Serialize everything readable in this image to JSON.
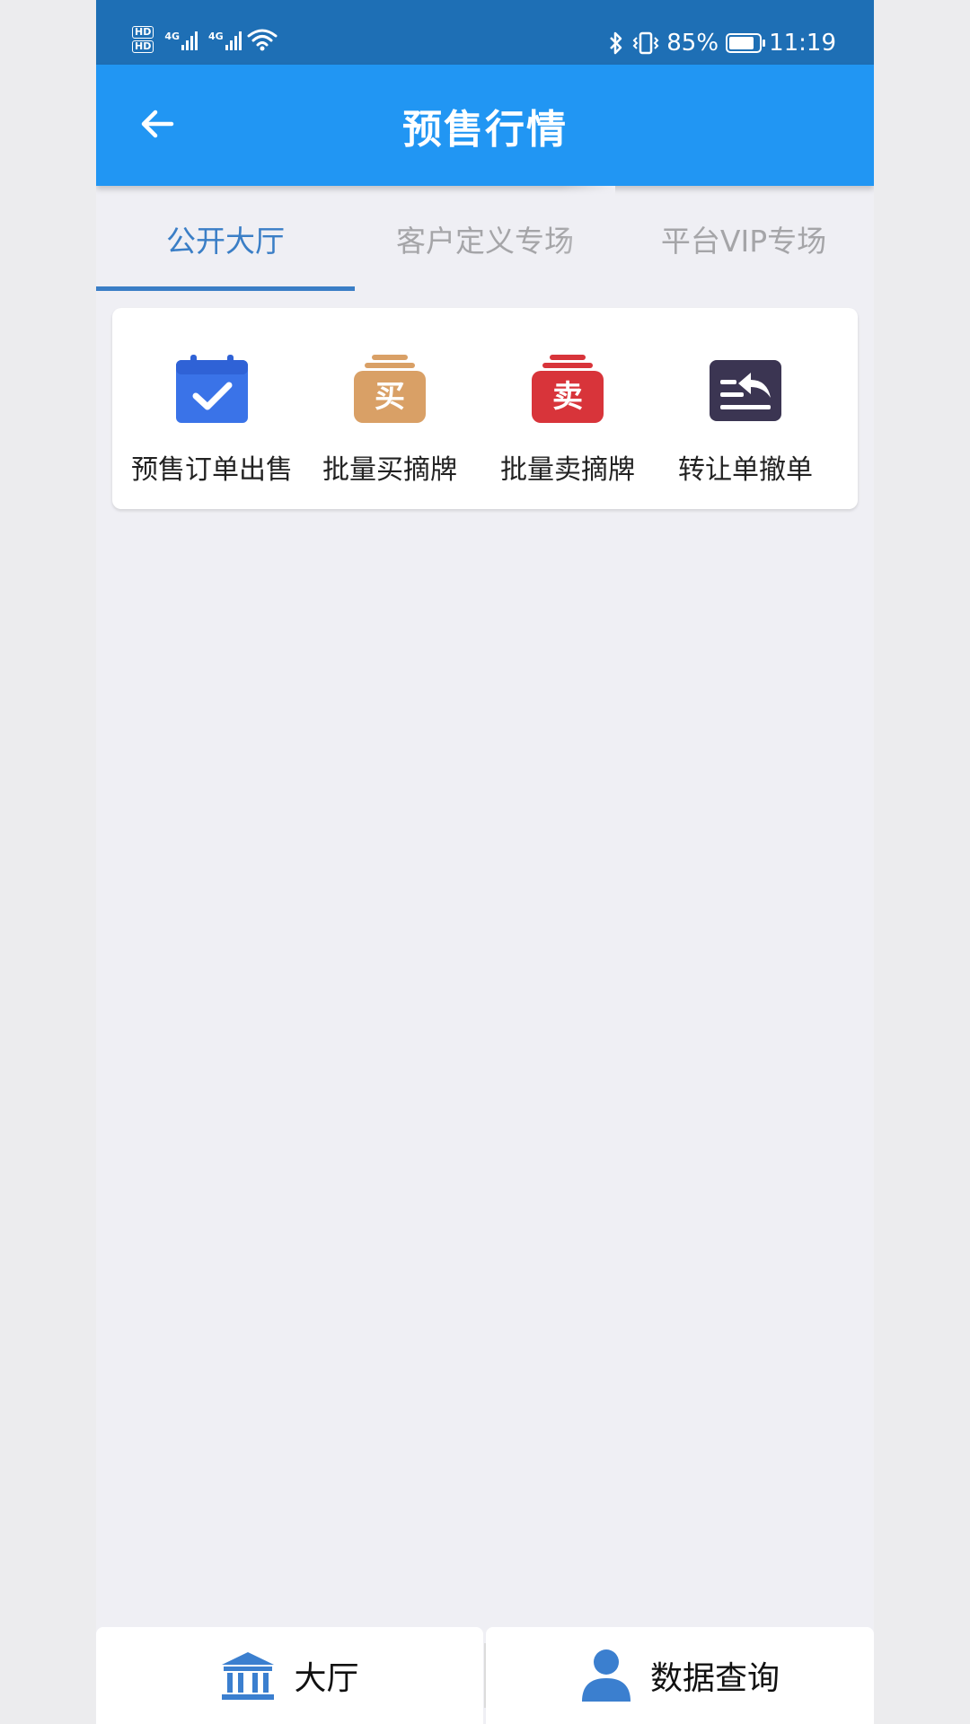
{
  "status_bar": {
    "sim1_badge": "HD",
    "sim2_badge": "HD",
    "network1": "4G",
    "network2": "4G",
    "battery_percent": "85%",
    "battery_level": 0.85,
    "time": "11:19",
    "icons": [
      "wifi-icon",
      "bluetooth-icon",
      "vibrate-icon",
      "battery-icon"
    ]
  },
  "app_bar": {
    "title": "预售行情",
    "back_icon": "arrow-left-icon"
  },
  "tabs": [
    {
      "label": "公开大厅",
      "active": true
    },
    {
      "label": "客户定义专场",
      "active": false
    },
    {
      "label": "平台VIP专场",
      "active": false
    }
  ],
  "actions": [
    {
      "label": "预售订单出售",
      "icon": "calendar-check-icon",
      "color": "#3a73e8"
    },
    {
      "label": "批量买摘牌",
      "icon": "buy-stamp-icon",
      "glyph": "买",
      "color": "#d9a066"
    },
    {
      "label": "批量卖摘牌",
      "icon": "sell-stamp-icon",
      "glyph": "卖",
      "color": "#d8343a"
    },
    {
      "label": "转让单撤单",
      "icon": "revoke-icon",
      "color": "#3b3552"
    }
  ],
  "bottom_nav": [
    {
      "label": "大厅",
      "icon": "bank-icon"
    },
    {
      "label": "数据查询",
      "icon": "user-icon"
    }
  ],
  "colors": {
    "status_bar": "#1e6fb5",
    "app_bar": "#2196f3",
    "tab_active": "#3a7ec6",
    "tab_inactive": "#a5a5a8",
    "background": "#efeff4",
    "nav_icon": "#3b7fcf"
  }
}
